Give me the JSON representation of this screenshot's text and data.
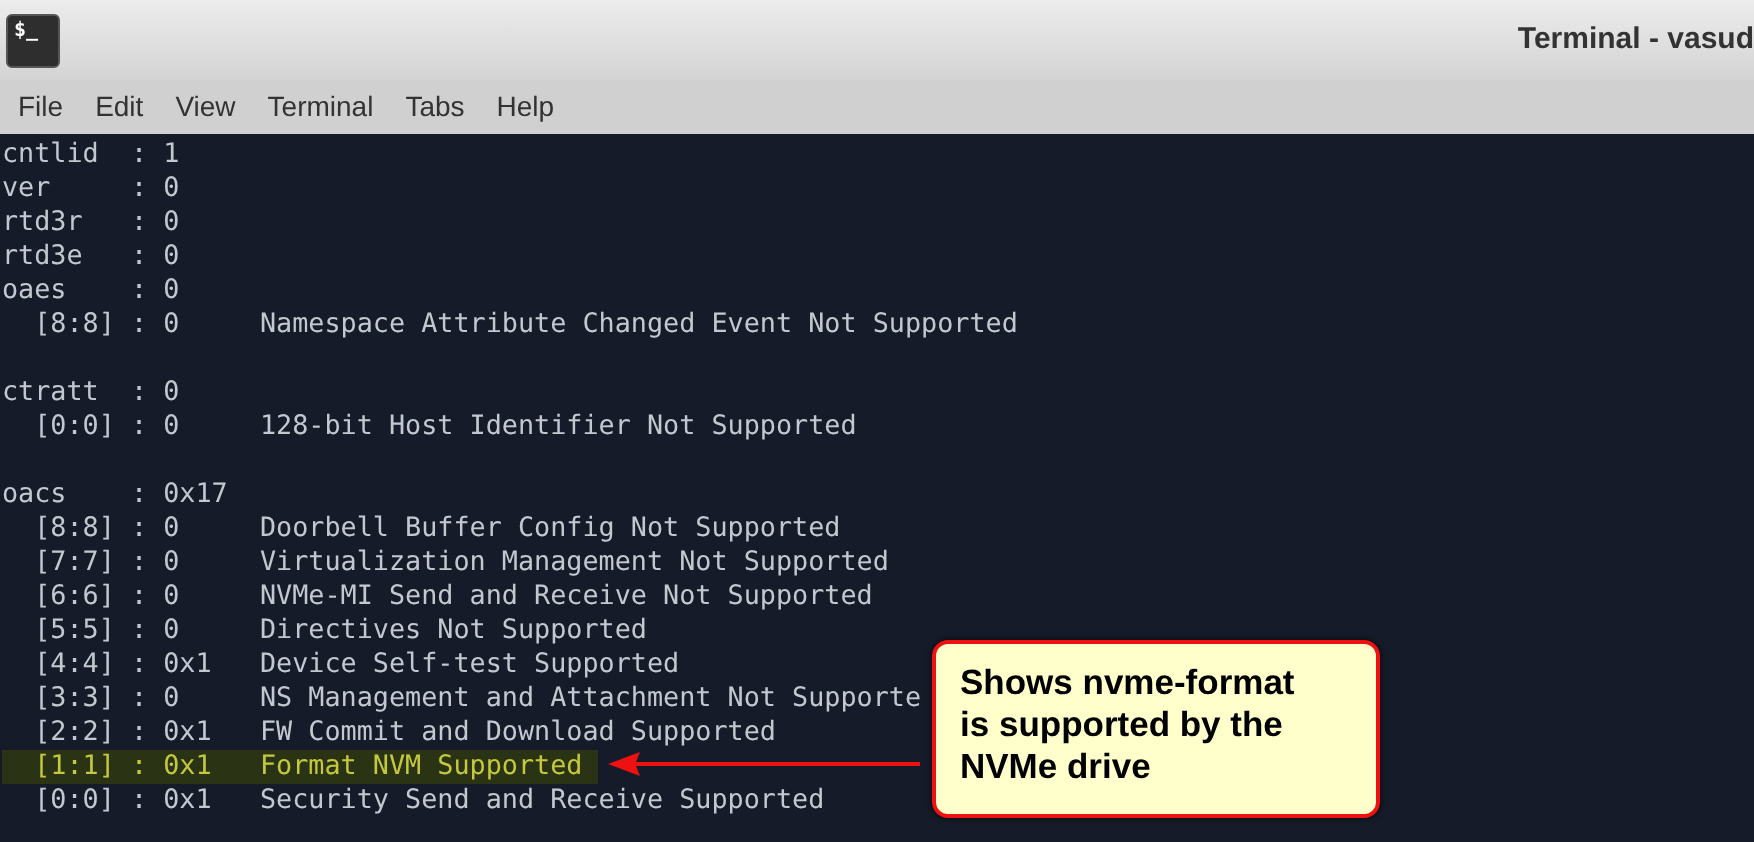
{
  "window": {
    "app_icon": "$_",
    "title": "Terminal - vasud"
  },
  "menu": [
    "File",
    "Edit",
    "View",
    "Terminal",
    "Tabs",
    "Help"
  ],
  "groups": [
    {
      "lines": [
        {
          "text": "cntlid  : 1",
          "highlighted": false
        },
        {
          "text": "ver     : 0",
          "highlighted": false
        },
        {
          "text": "rtd3r   : 0",
          "highlighted": false
        },
        {
          "text": "rtd3e   : 0",
          "highlighted": false
        },
        {
          "text": "oaes    : 0",
          "highlighted": false
        },
        {
          "text": "  [8:8] : 0     Namespace Attribute Changed Event Not Supported",
          "highlighted": false
        }
      ]
    },
    {
      "lines": [
        {
          "text": "ctratt  : 0",
          "highlighted": false
        },
        {
          "text": "  [0:0] : 0     128-bit Host Identifier Not Supported",
          "highlighted": false
        }
      ]
    },
    {
      "lines": [
        {
          "text": "oacs    : 0x17",
          "highlighted": false
        },
        {
          "text": "  [8:8] : 0     Doorbell Buffer Config Not Supported",
          "highlighted": false
        },
        {
          "text": "  [7:7] : 0     Virtualization Management Not Supported",
          "highlighted": false
        },
        {
          "text": "  [6:6] : 0     NVMe-MI Send and Receive Not Supported",
          "highlighted": false
        },
        {
          "text": "  [5:5] : 0     Directives Not Supported",
          "highlighted": false
        },
        {
          "text": "  [4:4] : 0x1   Device Self-test Supported",
          "highlighted": false
        },
        {
          "text": "  [3:3] : 0     NS Management and Attachment Not Supporte",
          "highlighted": false
        },
        {
          "text": "  [2:2] : 0x1   FW Commit and Download Supported",
          "highlighted": false
        },
        {
          "text": "  [1:1] : 0x1   Format NVM Supported",
          "highlighted": true
        },
        {
          "text": "  [0:0] : 0x1   Security Send and Receive Supported",
          "highlighted": false
        }
      ]
    }
  ],
  "callout": {
    "text": "Shows nvme-format is supported by the NVMe drive"
  }
}
